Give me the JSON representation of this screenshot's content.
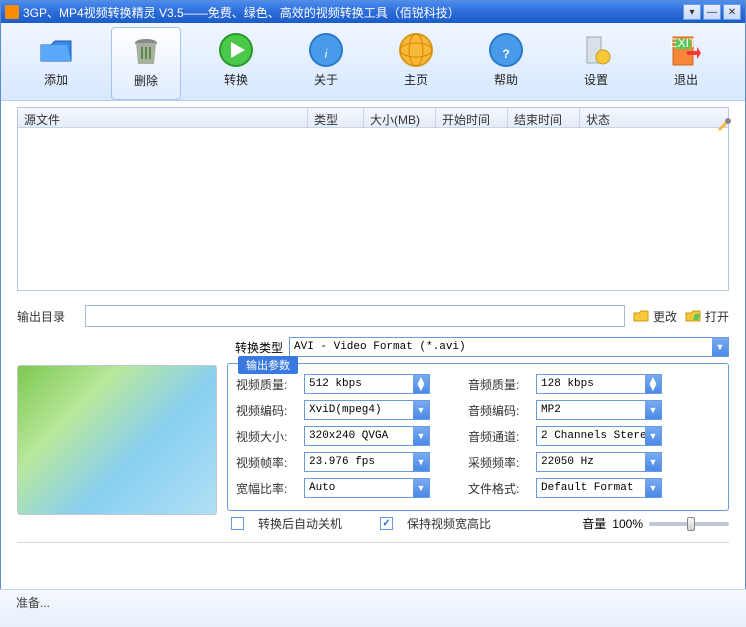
{
  "title": "3GP、MP4视频转换精灵 V3.5——免费、绿色、高效的视频转换工具（佰锐科技）",
  "toolbar": {
    "add": "添加",
    "delete": "删除",
    "convert": "转换",
    "about": "关于",
    "home": "主页",
    "help": "帮助",
    "settings": "设置",
    "exit": "退出"
  },
  "columns": {
    "source": "源文件",
    "type": "类型",
    "size": "大小(MB)",
    "start": "开始时间",
    "end": "结束时间",
    "status": "状态"
  },
  "output": {
    "label": "输出目录",
    "value": "",
    "change": "更改",
    "open": "打开"
  },
  "convtype": {
    "label": "转换类型",
    "value": "AVI - Video Format (*.avi)"
  },
  "params": {
    "legend": "输出参数",
    "vquality_lbl": "视频质量:",
    "vquality": "512 kbps",
    "vcodec_lbl": "视频编码:",
    "vcodec": "XviD(mpeg4)",
    "vsize_lbl": "视频大小:",
    "vsize": "320x240 QVGA",
    "vfps_lbl": "视频帧率:",
    "vfps": "23.976 fps",
    "aspect_lbl": "宽幅比率:",
    "aspect": "Auto",
    "aquality_lbl": "音频质量:",
    "aquality": "128 kbps",
    "acodec_lbl": "音频编码:",
    "acodec": "MP2",
    "achan_lbl": "音频通道:",
    "achan": "2 Channels Stere",
    "srate_lbl": "采频频率:",
    "srate": "22050 Hz",
    "fformat_lbl": "文件格式:",
    "fformat": "Default Format"
  },
  "checks": {
    "shutdown": "转换后自动关机",
    "keepratio": "保持视频宽高比"
  },
  "volume": {
    "label": "音量",
    "value": "100%"
  },
  "status": "准备..."
}
